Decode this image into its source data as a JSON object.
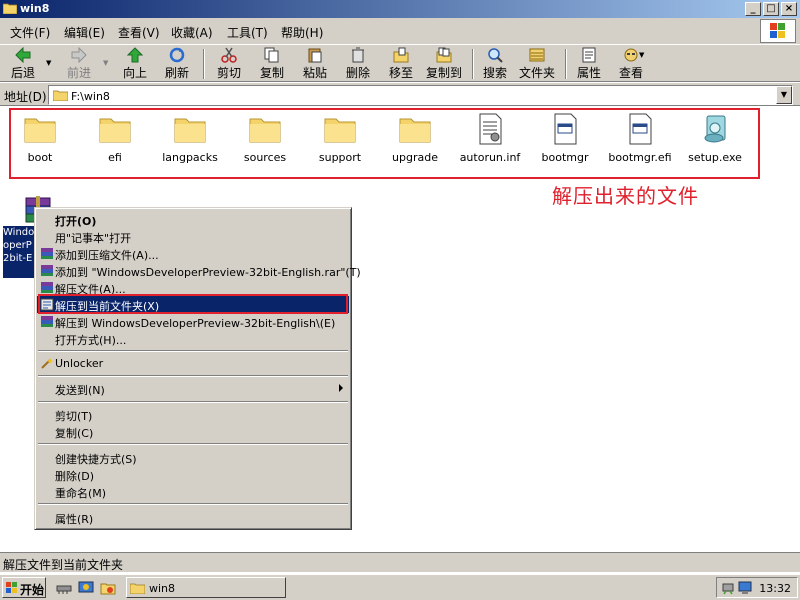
{
  "window": {
    "title": "win8"
  },
  "menubar": {
    "items": [
      "文件(F)",
      "编辑(E)",
      "查看(V)",
      "收藏(A)",
      "工具(T)",
      "帮助(H)"
    ]
  },
  "toolbar": {
    "back": "后退",
    "forward": "前进",
    "up": "向上",
    "refresh": "刷新",
    "cut": "剪切",
    "copy": "复制",
    "paste": "粘贴",
    "delete": "删除",
    "move_to": "移至",
    "copy_to": "复制到",
    "search": "搜索",
    "folders": "文件夹",
    "properties": "属性",
    "views": "查看"
  },
  "address": {
    "label": "地址(D)",
    "value": "F:\\win8"
  },
  "files": [
    {
      "name": "boot",
      "icon": "folder-icon"
    },
    {
      "name": "efi",
      "icon": "folder-icon"
    },
    {
      "name": "langpacks",
      "icon": "folder-icon"
    },
    {
      "name": "sources",
      "icon": "folder-icon"
    },
    {
      "name": "support",
      "icon": "folder-icon"
    },
    {
      "name": "upgrade",
      "icon": "folder-icon"
    },
    {
      "name": "autorun.inf",
      "icon": "settings-file-icon"
    },
    {
      "name": "bootmgr",
      "icon": "system-file-icon"
    },
    {
      "name": "bootmgr.efi",
      "icon": "system-file-icon"
    },
    {
      "name": "setup.exe",
      "icon": "setup-icon"
    }
  ],
  "annotation": "解压出来的文件",
  "selected_file": {
    "label": "Windo\noperP\n2bit-E"
  },
  "context_menu": {
    "items": {
      "open": "打开(O)",
      "open_notepad": "用\"记事本\"打开",
      "add_archive": "添加到压缩文件(A)...",
      "add_rar": "添加到 \"WindowsDeveloperPreview-32bit-English.rar\"(T)",
      "extract_files": "解压文件(A)...",
      "extract_here": "解压到当前文件夹(X)",
      "extract_to": "解压到 WindowsDeveloperPreview-32bit-English\\(E)",
      "open_with": "打开方式(H)...",
      "unlocker": "Unlocker",
      "send_to": "发送到(N)",
      "cut": "剪切(T)",
      "copy": "复制(C)",
      "create_shortcut": "创建快捷方式(S)",
      "delete": "删除(D)",
      "rename": "重命名(M)",
      "properties": "属性(R)"
    }
  },
  "statusbar": {
    "text": "解压文件到当前文件夹"
  },
  "taskbar": {
    "start": "开始",
    "task": "win8",
    "clock": "13:32"
  },
  "colors": {
    "annotation_red": "#e0202c",
    "selection": "#0a246a",
    "face": "#d4d0c8"
  }
}
